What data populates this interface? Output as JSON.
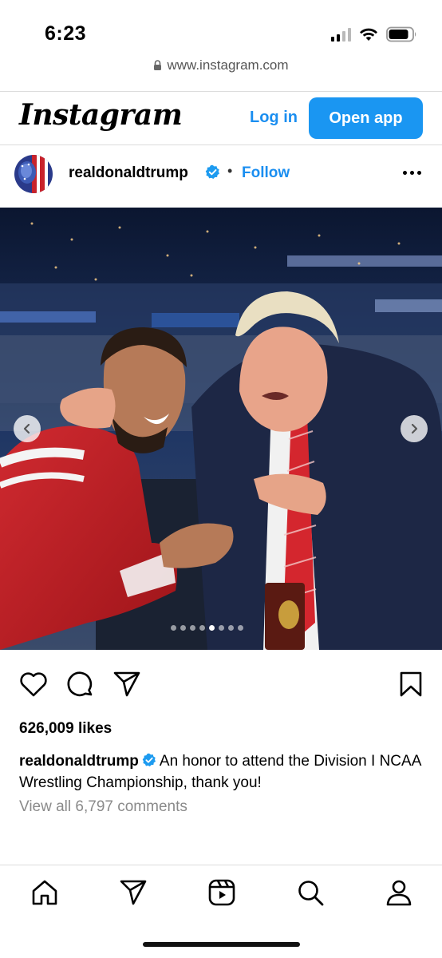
{
  "status_bar": {
    "time": "6:23",
    "icons": [
      "signal-icon",
      "wifi-icon",
      "battery-icon"
    ]
  },
  "browser": {
    "url": "www.instagram.com",
    "lock_icon": "lock-icon"
  },
  "header": {
    "logo": "Instagram",
    "login_label": "Log in",
    "open_app_label": "Open app"
  },
  "post": {
    "username": "realdonaldtrump",
    "verified": true,
    "separator": "•",
    "follow_label": "Follow",
    "carousel": {
      "total": 8,
      "active_index": 4
    },
    "likes": "626,009 likes",
    "caption_user": "realdonaldtrump",
    "caption_text": "An honor to attend the Division I NCAA Wrestling Championship, thank you!",
    "view_comments": "View all 6,797 comments"
  },
  "bottom_nav": [
    "home-icon",
    "send-icon",
    "reels-icon",
    "search-icon",
    "profile-icon"
  ],
  "colors": {
    "accent": "#1a96f2",
    "link": "#1a8ef0",
    "verified": "#1d9bf0",
    "muted": "#8a8a8a"
  }
}
